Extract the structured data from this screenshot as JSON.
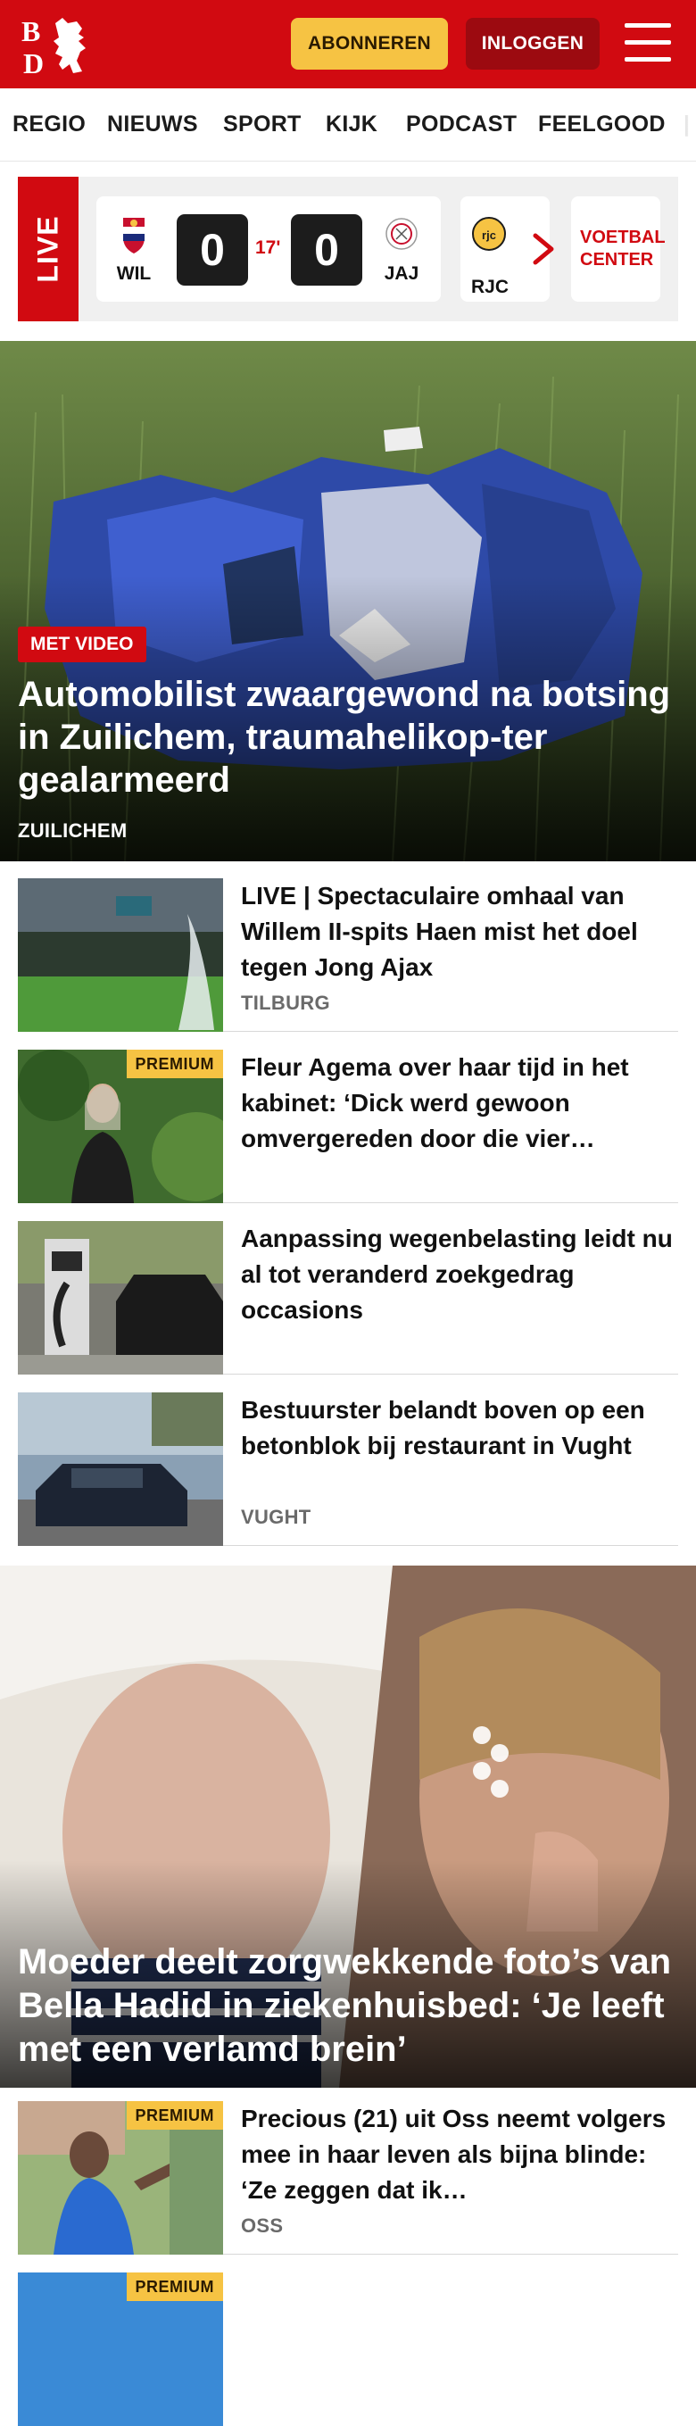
{
  "header": {
    "logo_text": "BD",
    "subscribe_label": "ABONNEREN",
    "login_label": "INLOGGEN",
    "brand_color": "#d10a11"
  },
  "nav": {
    "items": [
      "REGIO",
      "NIEUWS",
      "SPORT",
      "KIJK",
      "PODCAST",
      "FEELGOOD"
    ]
  },
  "live": {
    "tag": "LIVE",
    "match": {
      "home": "WIL",
      "away": "JAJ",
      "home_score": "0",
      "away_score": "0",
      "minute": "17'"
    },
    "next_team": "RJC",
    "voetbal_center": "VOETBAL CENTER"
  },
  "hero": {
    "badge": "MET VIDEO",
    "title": "Automobilist zwaargewond na botsing in Zuilichem, traumahelikop-ter gealarmeerd",
    "location": "ZUILICHEM"
  },
  "articles": [
    {
      "title": "LIVE | Spectaculaire omhaal van Willem II-spits Haen mist het doel tegen Jong Ajax",
      "location": "TILBURG",
      "premium": ""
    },
    {
      "title": "Fleur Agema over haar tijd in het kabinet: ‘Dick werd gewoon omvergereden door die vier…",
      "location": "",
      "premium": "PREMIUM"
    },
    {
      "title": "Aanpassing wegenbelasting leidt nu al tot veranderd zoekgedrag occasions",
      "location": "",
      "premium": ""
    },
    {
      "title": "Bestuurster belandt boven op een betonblok bij restaurant in Vught",
      "location": "VUGHT",
      "premium": ""
    }
  ],
  "hero2": {
    "title": "Moeder deelt zorgwekkende foto’s van Bella Hadid in ziekenhuisbed: ‘Je leeft met een verlamd brein’"
  },
  "articles2": [
    {
      "title": "Precious (21) uit Oss neemt volgers mee in haar leven als bijna blinde: ‘Ze zeggen dat ik…",
      "location": "OSS",
      "premium": "PREMIUM"
    },
    {
      "title": "",
      "location": "",
      "premium": "PREMIUM"
    }
  ]
}
